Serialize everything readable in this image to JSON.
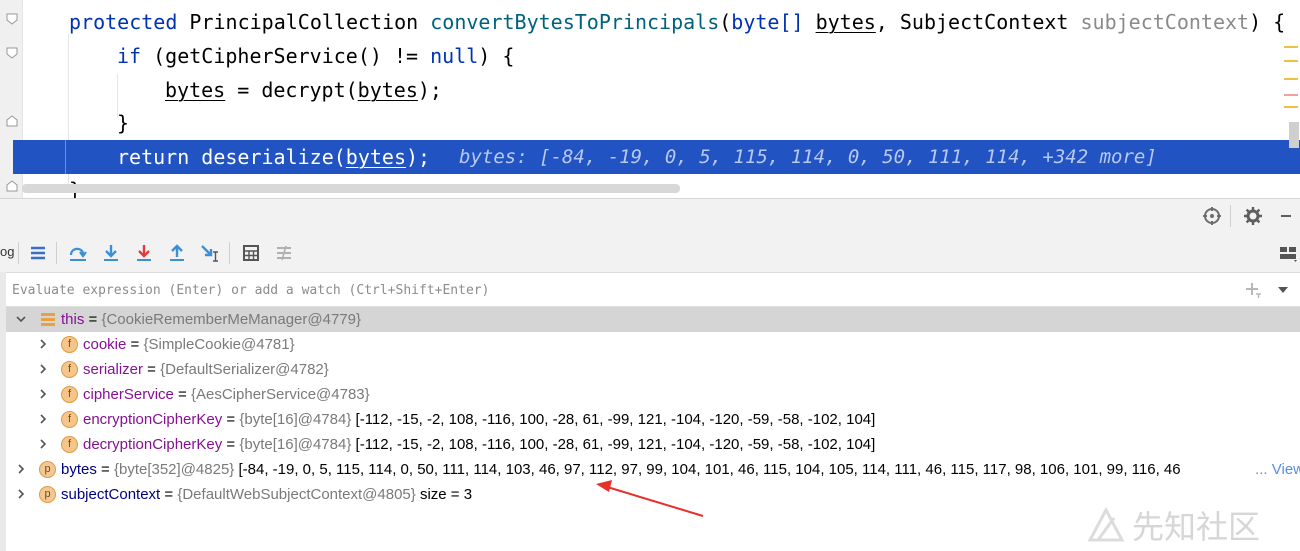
{
  "editor": {
    "lines": {
      "signature": {
        "kw": "protected",
        "type": "PrincipalCollection",
        "method": "convertBytesToPrincipals",
        "open": "(",
        "ptype": "byte[]",
        "pname": "bytes",
        "comma": ", SubjectContext ",
        "pname2": "subjectContext",
        "close": ") {"
      },
      "if_line": {
        "kw": "if",
        "rest1": " (getCipherService() != ",
        "null": "null",
        "rest2": ") {"
      },
      "assign_line": {
        "var": "bytes",
        "mid": " = decrypt(",
        "arg": "bytes",
        "end": ");"
      },
      "close_if": "}",
      "return_line": {
        "kw": "return",
        "mid": " deserialize(",
        "arg": "bytes",
        "end": ");"
      },
      "inline_value": "bytes: [-84, -19, 0, 5, 115, 114, 0, 50, 111, 114, +342 more]",
      "close_method": "}"
    }
  },
  "toolbar": {
    "truncated_tab_label": "og"
  },
  "watch": {
    "placeholder": "Evaluate expression (Enter) or add a watch (Ctrl+Shift+Enter)"
  },
  "variables": [
    {
      "name": "this",
      "eq": " = ",
      "type": "{CookieRememberMeManager@4779}",
      "value": "",
      "badge": "",
      "kind": "this"
    },
    {
      "name": "cookie",
      "eq": " = ",
      "type": "{SimpleCookie@4781}",
      "value": "",
      "badge": "f"
    },
    {
      "name": "serializer",
      "eq": " = ",
      "type": "{DefaultSerializer@4782}",
      "value": "",
      "badge": "f"
    },
    {
      "name": "cipherService",
      "eq": " = ",
      "type": "{AesCipherService@4783}",
      "value": "",
      "badge": "f"
    },
    {
      "name": "encryptionCipherKey",
      "eq": " = ",
      "type": "{byte[16]@4784}",
      "value": " [-112, -15, -2, 108, -116, 100, -28, 61, -99, 121, -104, -120, -59, -58, -102, 104]",
      "badge": "f"
    },
    {
      "name": "decryptionCipherKey",
      "eq": " = ",
      "type": "{byte[16]@4784}",
      "value": " [-112, -15, -2, 108, -116, 100, -28, 61, -99, 121, -104, -120, -59, -58, -102, 104]",
      "badge": "f"
    },
    {
      "name": "bytes",
      "eq": " = ",
      "type": "{byte[352]@4825}",
      "value": " [-84, -19, 0, 5, 115, 114, 0, 50, 111, 114, 103, 46, 97, 112, 97, 99, 104, 101, 46, 115, 104, 105, 114, 111, 46, 115, 117, 98, 106, 101, 99, 116, 46",
      "badge": "p",
      "link": "... View"
    },
    {
      "name": "subjectContext",
      "eq": " = ",
      "type": "{DefaultWebSubjectContext@4805}",
      "value": "  size = 3",
      "badge": "p"
    }
  ],
  "watermark": "先知社区",
  "colors": {
    "exec_line": "#2154c2",
    "field_badge": "#f5c68a",
    "field_name": "#871094",
    "local_name": "#000080",
    "annotation_arrow": "#e8302a"
  }
}
